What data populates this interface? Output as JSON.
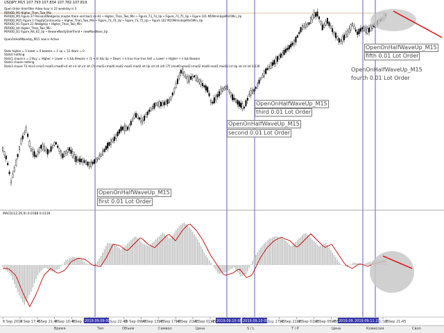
{
  "symbol_header": "USDJPY,M15  107.793 107.834 107.782 107.819",
  "overlay_lines": [
    "Open Order timeFilter Allow hour is 22 weekday is 3",
    "PERIOD_M1     Higher_Than_Two_Min",
    "PERIOD_M5     Figure 37 PennantWedge(so maybe there and back on H1  •  Higher_Than_Two_Min  •  Figure_73_74_Up  •  Figure_73_75_Up  •  Figure 101 M5Mmin$qaMin5Min_Up",
    "PERIOD_M15   Figure 1 FlagUpContinueUp  •  Higher_Than_Two_Min  •  Figure_73_74_Up  •  Figure_73_75_Up  •  Figure 102 M15Mmin$qaMin5Min_Up",
    "PERIOD_H1     Figure 21 WedgeUp  •  Higher_Than_Two_Min",
    "PERIOD_H4     Higher_Than_Two_Min",
    "PERIOD_D1     Figure_N4_62_Up  •  BewareNastySideTrend  •  newMaxWave_Up",
    "",
    "OpenOnHalfWaveUp_M15 now is Active",
    "",
    "",
    "Stats      higher = 5 lower = 0 beware = 1 up = 12 down = 0",
    "Stats0    nothing",
    "Stats1 clause  k = 2  Buy = Higher > Lower + k && Beware < (1 + k) && Up > Down + k true true true Sell = Lower > Higher + k && Beware",
    "Stats2 clause nothing",
    "Stats3 clause 73 min1<min5 mad1<mad0+0 int int int int int  (74 mad1<mad0 mad2 mad1 mad2 int Up int int int)  (75 (mad0>mad1>mad2 mad0 mad1 mad2) int Up int int int 0.236"
  ],
  "annotations": [
    {
      "kind": "box",
      "text": "OpenOnHalfWaveUp_M15"
    },
    {
      "kind": "box",
      "text": "first 0.01 Lot Order"
    },
    {
      "kind": "box",
      "text": "OpenOnHalfWaveUp_M15"
    },
    {
      "kind": "box",
      "text": "second 0.01 Lot Order"
    },
    {
      "kind": "box",
      "text": "OpenOnHalfWaveUp_M15"
    },
    {
      "kind": "box",
      "text": "third 0.01 Lot Order"
    },
    {
      "kind": "plain",
      "text": "OpenOnHalfWaveUp_M15"
    },
    {
      "kind": "plain",
      "text": "fourth 0.01 Lot Order"
    },
    {
      "kind": "box",
      "text": "OpenOnHalfWaveUp_M15"
    },
    {
      "kind": "box",
      "text": "fifth 0.01 Lot Order"
    }
  ],
  "macd_label": "MACD(12,26,9) 0.0188 0.0139",
  "time_labels": [
    "6 Sep 2019",
    "6 Sep 17:45",
    "6 Sep 21:45",
    "9 Sep 10:45",
    "9 Sep 14:45",
    "9 Sep 18:45",
    "9 Sep 22:45",
    "10 Sep 09:45",
    "10 Sep 13:45",
    "10 Sep 17:45",
    "10 Sep 21:45",
    "11 Sep 01:45",
    "11 Sep 05:45",
    "11 Sep 09:45",
    "11 Sep 13:45",
    "11 Sep 17:45",
    "11 Sep 21:45",
    "12 Sep 01:45",
    "12 Sep 05:45",
    "12 Sep 09:45",
    "12 Sep 13:45",
    "12 Sep 17:45",
    "12 Sep 21:45"
  ],
  "highlight_times": [
    "2019.09.09 09:45",
    "2019.09.10 08:15",
    "2019.09.10 09:30",
    "2019.09.11 18:45",
    "2019.09.11 23:45"
  ],
  "bottom_labels": [
    "Время",
    "Тип",
    "Объем",
    "Символ",
    "Цена",
    "S / L",
    "T / P",
    "Цена",
    "Комиссия",
    "Своп"
  ],
  "colors": {
    "candle": "#000000",
    "macd_hist": "#c0c0c0",
    "signal": "#c00000",
    "vline": "#3333aa",
    "trend": "#e00000",
    "ellipse": "#c8c8c8",
    "bg": "#ffffff"
  }
}
